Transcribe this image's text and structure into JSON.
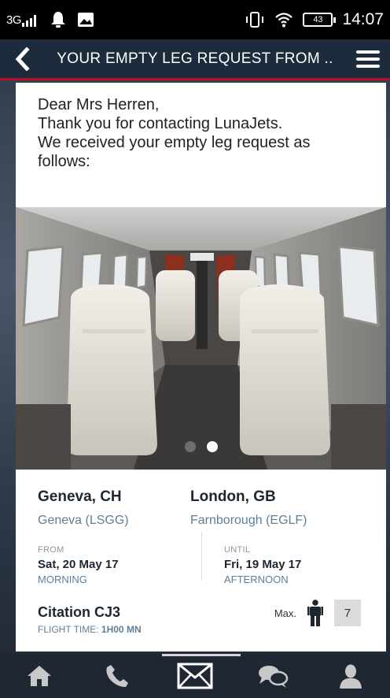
{
  "status_bar": {
    "network": "3G",
    "battery": "43",
    "time": "14:07",
    "icons": [
      "signal-icon",
      "notification-icon",
      "image-icon",
      "vibrate-icon",
      "wifi-icon",
      "battery-icon"
    ]
  },
  "header": {
    "title": "YOUR EMPTY LEG REQUEST FROM ..",
    "back_icon": "chevron-left-icon",
    "menu_icon": "hamburger-menu-icon",
    "background": "#1d2c3d",
    "accent": "#b8102a"
  },
  "message": {
    "greeting": "Dear Mrs Herren,",
    "line1": "Thank you for contacting LunaJets.",
    "line2": "We received your empty leg request as follows:"
  },
  "carousel": {
    "slides": 2,
    "active_index": 1
  },
  "route": {
    "from": {
      "city": "Geneva, CH",
      "airport": "Geneva (LSGG)",
      "label": "FROM",
      "date": "Sat, 20 May 17",
      "time_of_day": "MORNING"
    },
    "to": {
      "city": "London, GB",
      "airport": "Farnborough (EGLF)",
      "label": "UNTIL",
      "date": "Fri, 19 May 17",
      "time_of_day": "AFTERNOON"
    }
  },
  "aircraft": {
    "name": "Citation CJ3",
    "flight_time_label": "FLIGHT TIME:",
    "flight_time_value": "1H00 MN",
    "max_label": "Max.",
    "max_passengers": "7"
  },
  "bottom_nav": {
    "items": [
      "home-icon",
      "phone-icon",
      "mail-icon",
      "chat-icon",
      "profile-icon"
    ],
    "active": "mail-icon"
  }
}
